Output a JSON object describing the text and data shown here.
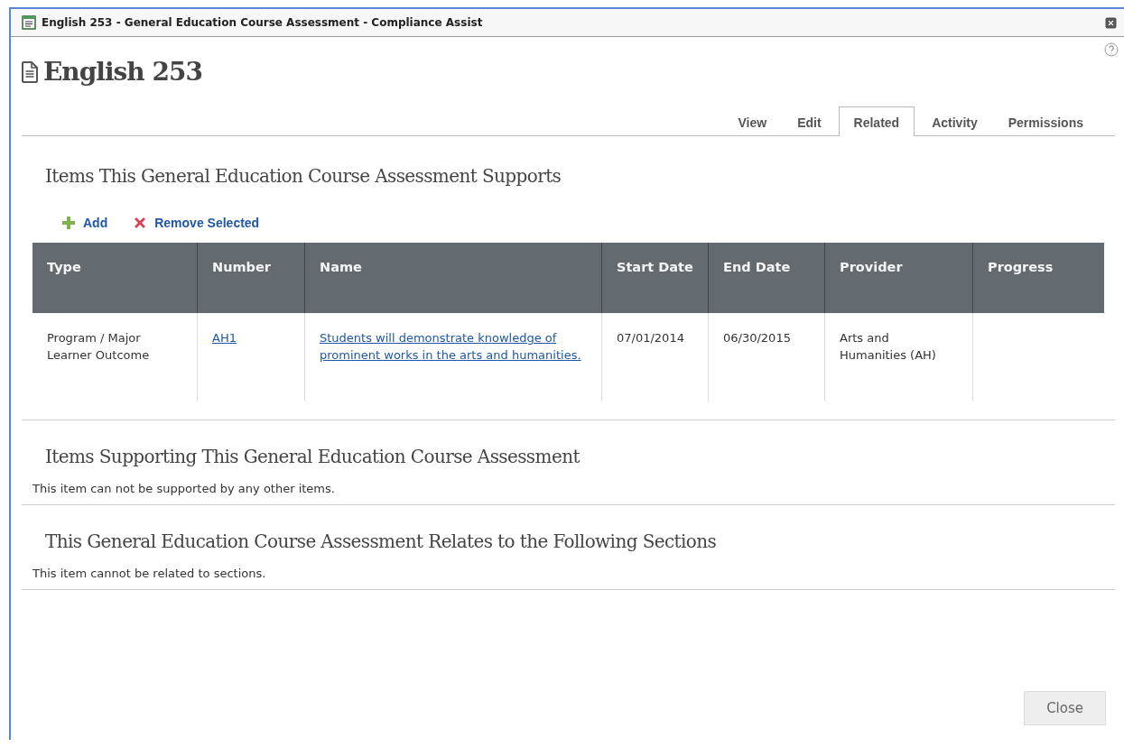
{
  "window": {
    "title": "English 253 - General Education Course Assessment - Compliance Assist"
  },
  "heading": "English 253",
  "tabs": [
    {
      "label": "View",
      "selected": false
    },
    {
      "label": "Edit",
      "selected": false
    },
    {
      "label": "Related",
      "selected": true
    },
    {
      "label": "Activity",
      "selected": false
    },
    {
      "label": "Permissions",
      "selected": false
    }
  ],
  "sections": [
    {
      "title": "Items This General Education Course Assessment Supports",
      "toolbar": [
        {
          "kind": "add",
          "label": "Add"
        },
        {
          "kind": "remove",
          "label": "Remove Selected"
        }
      ],
      "table": {
        "columns": [
          "Type",
          "Number",
          "Name",
          "Start Date",
          "End Date",
          "Provider",
          "Progress"
        ],
        "rows": [
          [
            "Program / Major Learner Outcome",
            {
              "link": "AH1"
            },
            {
              "link": "Students will demonstrate knowledge of prominent works in the arts and humanities."
            },
            "07/01/2014",
            "06/30/2015",
            "Arts and Humanities (AH)",
            ""
          ]
        ]
      }
    },
    {
      "title": "Items Supporting This General Education Course Assessment",
      "note": "This item can not be supported by any other items."
    },
    {
      "title": "This General Education Course Assessment Relates to the Following Sections",
      "note": "This item cannot be related to sections."
    }
  ],
  "buttons": [
    "Close"
  ]
}
